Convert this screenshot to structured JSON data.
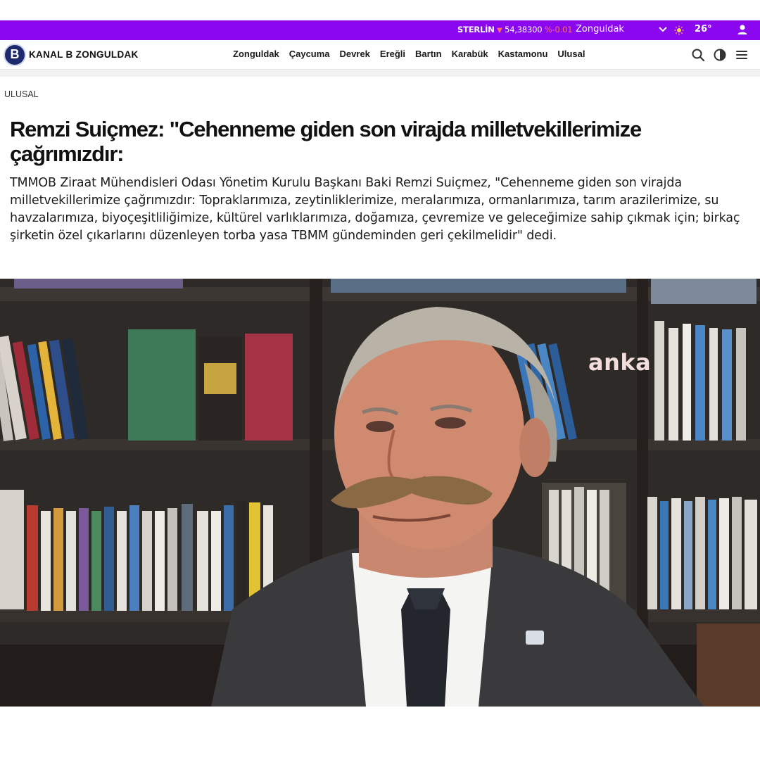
{
  "ticker": {
    "currency_name": "STERLİN",
    "currency_arrow": "▼",
    "currency_value": "54,38300",
    "currency_change": "%-0.01",
    "city": "Zonguldak",
    "temperature": "26°",
    "icons": [
      "chevron-down-icon",
      "sun-icon",
      "user-icon"
    ]
  },
  "header": {
    "logo_letter": "B",
    "brand": "KANAL B  ZONGULDAK",
    "nav": [
      "Zonguldak",
      "Çaycuma",
      "Devrek",
      "Ereğli",
      "Bartın",
      "Karabük",
      "Kastamonu",
      "Ulusal"
    ],
    "icons": [
      "search-icon",
      "theme-toggle-icon",
      "menu-icon"
    ]
  },
  "article": {
    "category": "ULUSAL",
    "title": "Remzi Suiçmez: \"Cehenneme giden son virajda milletvekillerimize çağrımızdır:",
    "summary": "TMMOB Ziraat Mühendisleri Odası Yönetim Kurulu Başkanı Baki Remzi Suiçmez, \"Cehenneme giden son virajda milletvekillerimize çağrımızdır: Topraklarımıza, zeytinliklerimize, meralarımıza, ormanlarımıza, tarım arazilerimize, su havzalarımıza, biyoçeşitliliğimize, kültürel varlıklarımıza, doğamıza, çevremize ve geleceğimize sahip çıkmak için; birkaç şirketin özel çıkarlarını düzenleyen torba yasa TBMM gündeminden geri çekilmelidir\" dedi.",
    "photo_watermark": "anka"
  },
  "colors": {
    "ticker_bg": "#8a07f0",
    "negative": "#ff6b6b"
  }
}
